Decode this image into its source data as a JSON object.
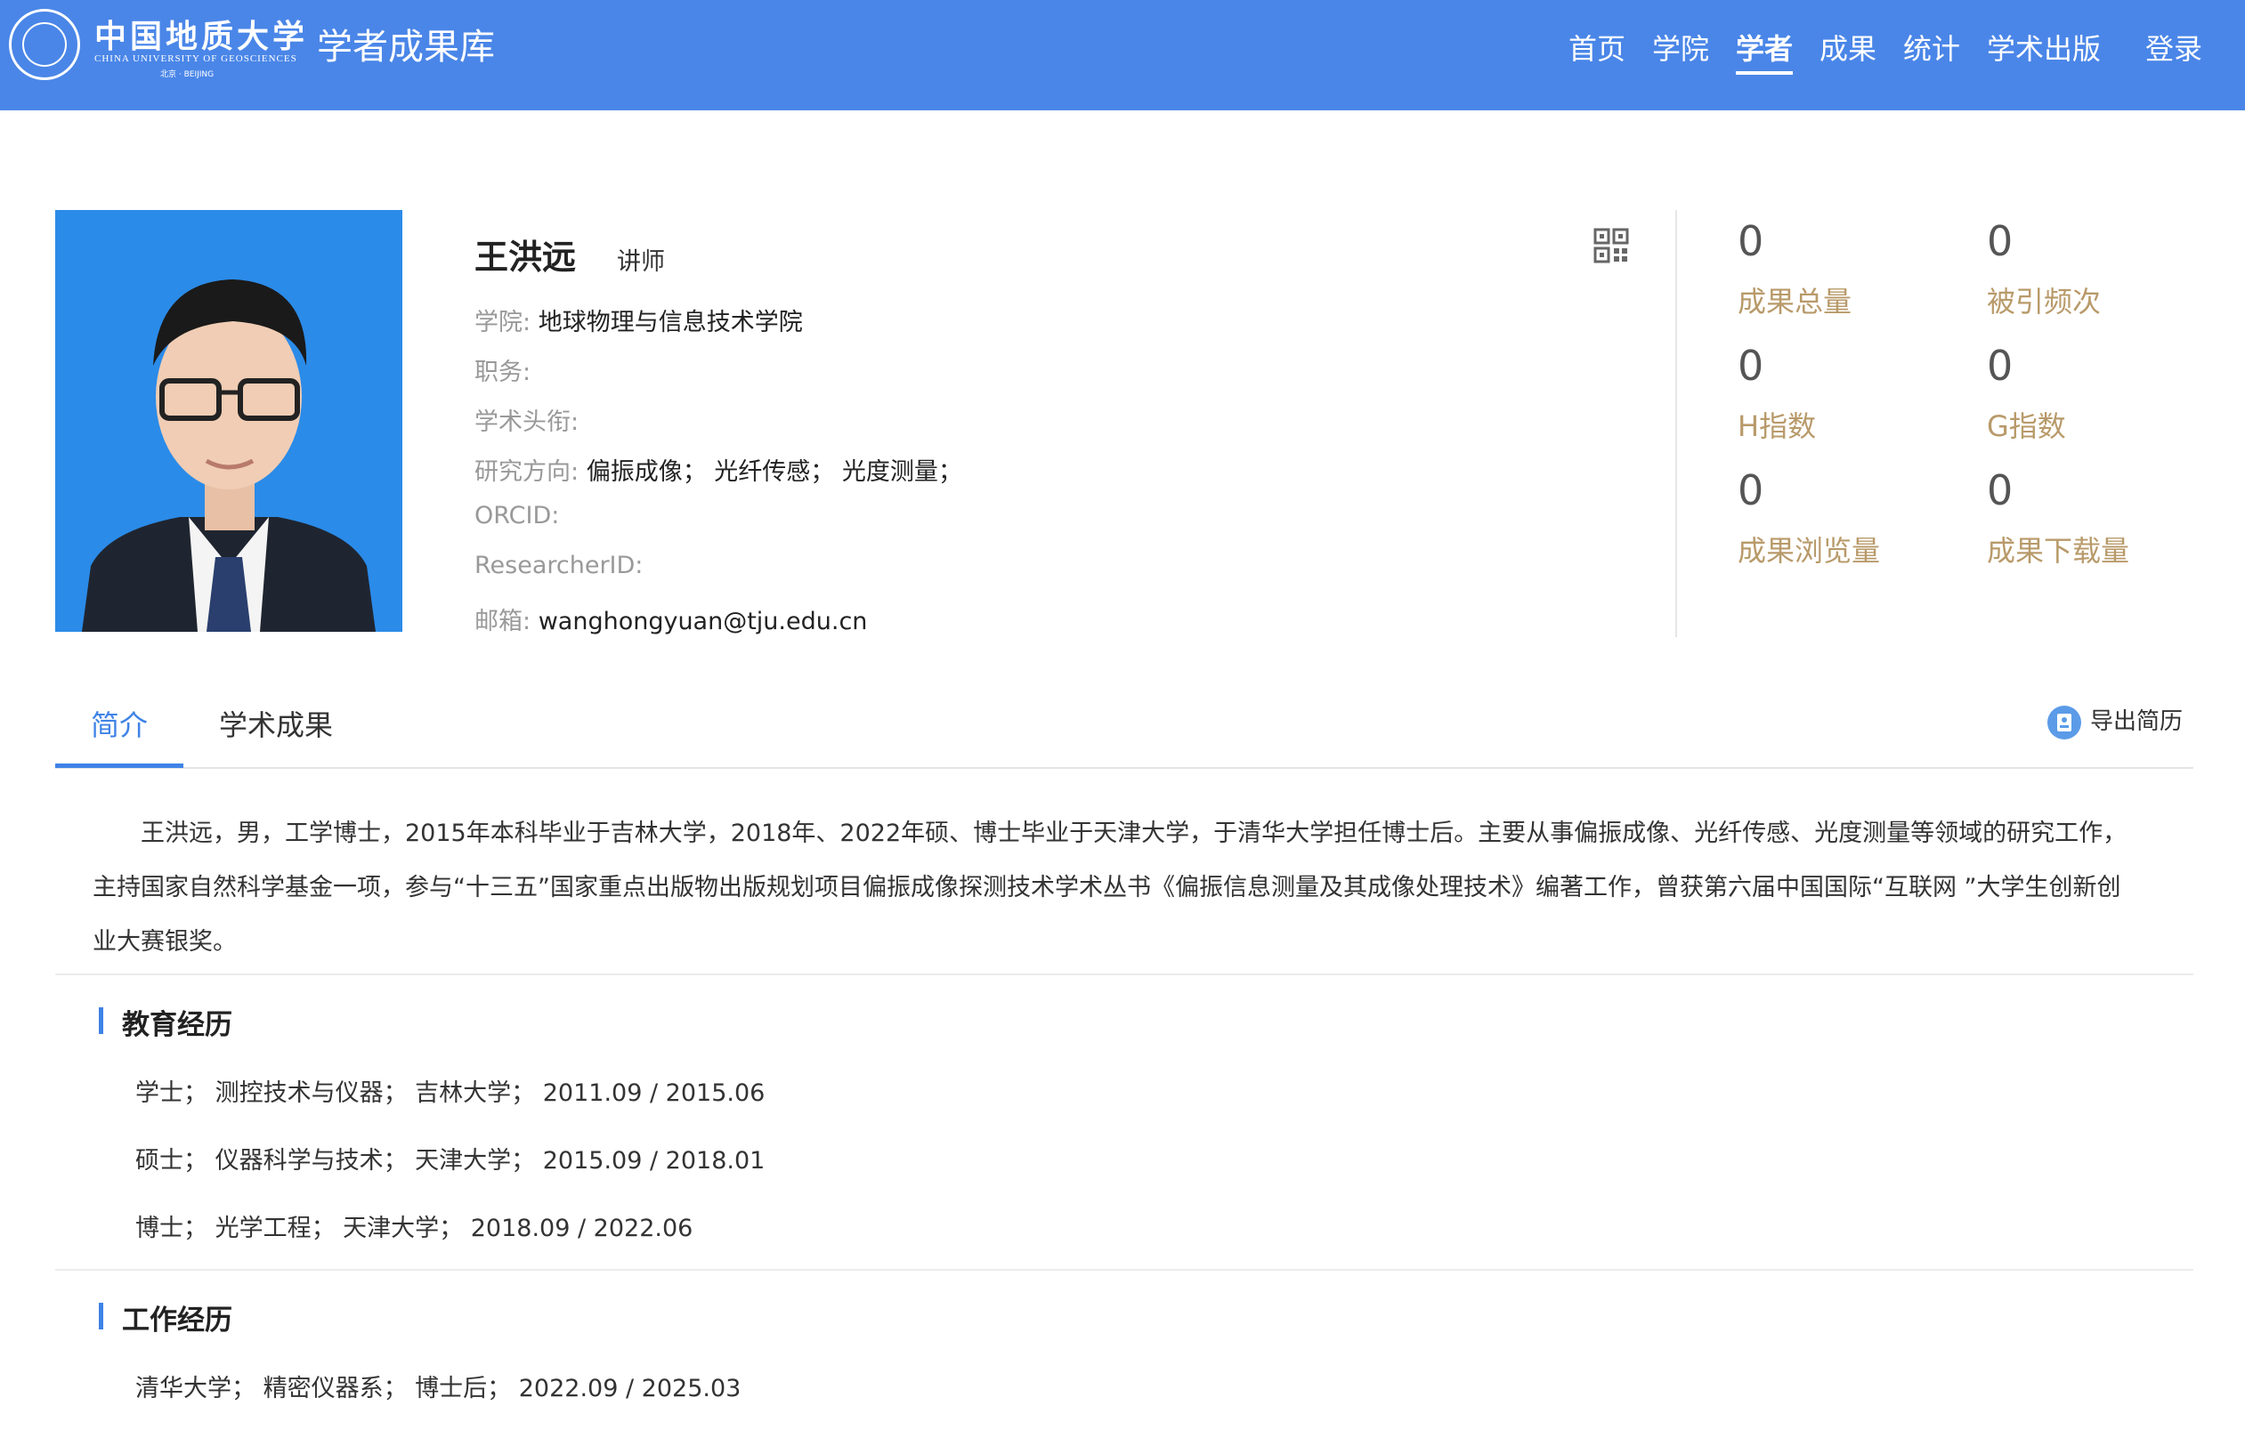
{
  "header": {
    "logo_icon": "university-seal-icon",
    "university_cn": "中国地质大学",
    "university_en": "CHINA UNIVERSITY OF GEOSCIENCES",
    "university_en_sub": "北京 · BEIJING",
    "site_title": "学者成果库",
    "nav": [
      "首页",
      "学院",
      "学者",
      "成果",
      "统计",
      "学术出版"
    ],
    "active_nav": "学者",
    "login": "登录"
  },
  "profile": {
    "name": "王洪远",
    "rank": "讲师",
    "college_label": "学院:",
    "college": "地球物理与信息技术学院",
    "position_label": "职务:",
    "position": "",
    "title_label": "学术头衔:",
    "title": "",
    "research_label": "研究方向:",
    "research": "偏振成像；  光纤传感；  光度测量；",
    "orcid_label": "ORCID:",
    "orcid": "",
    "researcherid_label": "ResearcherID:",
    "researcherid": "",
    "email_label": "邮箱:",
    "email": "wanghongyuan@tju.edu.cn",
    "qr_icon": "qr-code-icon"
  },
  "stats": [
    {
      "value": "0",
      "label": "成果总量"
    },
    {
      "value": "0",
      "label": "被引频次"
    },
    {
      "value": "0",
      "label": "H指数"
    },
    {
      "value": "0",
      "label": "G指数"
    },
    {
      "value": "0",
      "label": "成果浏览量"
    },
    {
      "value": "0",
      "label": "成果下载量"
    }
  ],
  "tabs": [
    "简介",
    "学术成果"
  ],
  "active_tab": "简介",
  "export": {
    "label": "导出简历",
    "icon": "resume-icon"
  },
  "bio_line1": "王洪远，男，工学博士，2015年本科毕业于吉林大学，2018年、2022年硕、博士毕业于天津大学，于清华大学担任博士后。主要从事偏振成像、光纤传感、光度测量等领域的研究工作，",
  "bio_line2": "主持国家自然科学基金一项，参与“十三五”国家重点出版物出版规划项目偏振成像探测技术学术丛书《偏振信息测量及其成像处理技术》编著工作，曾获第六届中国国际“互联网 ”大学生创新创",
  "bio_line3": "业大赛银奖。",
  "education": {
    "title": "教育经历",
    "items": [
      "学士；  测控技术与仪器；  吉林大学；  2011.09 / 2015.06",
      "硕士；  仪器科学与技术；  天津大学；  2015.09 / 2018.01",
      "博士；  光学工程；  天津大学；  2018.09 / 2022.06"
    ]
  },
  "work": {
    "title": "工作经历",
    "items": [
      "清华大学；  精密仪器系；  博士后；  2022.09 / 2025.03"
    ]
  },
  "colors": {
    "header_bg": "#4a86e8",
    "accent": "#3f83e6",
    "stat_label": "#b89a6a"
  }
}
